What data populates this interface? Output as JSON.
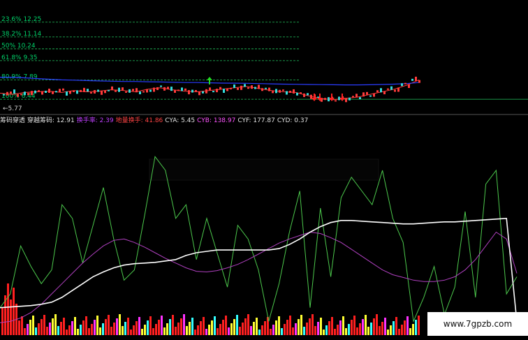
{
  "colors": {
    "background": "#000000",
    "fib_line": "#22c55e",
    "ma_blue": "#2a3cff",
    "candle_up": "#ff3b3b",
    "candle_down": "#33dddd",
    "green_line": "#4cc94c",
    "purple_line": "#b040c0",
    "white_line": "#ffffff",
    "vol_red": "#ff2020",
    "vol_yellow": "#ffff33",
    "vol_cyan": "#33ffff",
    "vol_magenta": "#ff33ff"
  },
  "chart_data": [
    {
      "type": "line",
      "fib_levels": [
        {
          "label": "23.6% 12.25",
          "value": 12.25
        },
        {
          "label": "38.2% 11.14",
          "value": 11.14
        },
        {
          "label": "50% 10.24",
          "value": 10.24
        },
        {
          "label": "61.8% 9.35",
          "value": 9.35
        },
        {
          "label": "80.9% 7.89",
          "value": 7.89
        },
        {
          "label": "100% 6.44",
          "value": 6.44
        }
      ],
      "low_label": "5.77",
      "low_value": 5.77,
      "ylim": [
        5.5,
        13.5
      ],
      "series": [
        {
          "color": "#ff3b3b",
          "values": [
            6.9,
            6.8,
            6.95,
            7.0,
            7.05,
            6.95,
            7.1,
            7.0,
            7.05,
            7.15,
            7.1,
            7.0,
            7.2,
            7.3,
            7.15,
            7.05,
            7.0,
            7.1,
            7.2,
            7.3,
            7.4,
            7.25,
            7.1,
            7.0,
            6.95,
            6.7,
            6.5,
            6.4,
            6.5,
            6.6,
            6.8,
            7.0,
            7.2,
            7.5,
            7.9
          ]
        },
        {
          "color": "#2a3cff",
          "values": [
            8.1,
            8.1,
            8.05,
            8.0,
            7.95,
            7.9,
            7.88,
            7.85,
            7.82,
            7.8,
            7.78,
            7.78,
            7.76,
            7.74,
            7.72,
            7.7,
            7.7,
            7.68,
            7.66,
            7.65,
            7.64,
            7.62,
            7.6,
            7.58,
            7.57,
            7.55,
            7.54,
            7.53,
            7.52,
            7.52,
            7.53,
            7.55,
            7.58,
            7.62,
            7.7
          ]
        }
      ]
    },
    {
      "type": "line",
      "indicator_labels": [
        {
          "text": "筹码穿透",
          "color": "#e0e0e0"
        },
        {
          "text": "穿越筹码: 12.91",
          "color": "#e0e0e0"
        },
        {
          "text": "换手率: 2.39",
          "color": "#c040ff"
        },
        {
          "text": "地量换手: 41.86",
          "color": "#ff4444"
        },
        {
          "text": "CYA: 5.45",
          "color": "#e0e0e0"
        },
        {
          "text": "CYB: 138.97",
          "color": "#ff55ff"
        },
        {
          "text": "CYF: 177.87",
          "color": "#e0e0e0"
        },
        {
          "text": "CYD: 0.37",
          "color": "#e0e0e0"
        }
      ],
      "ylim": [
        0,
        300
      ],
      "series": [
        {
          "color": "#4cc94c",
          "values": [
            40,
            60,
            130,
            100,
            75,
            95,
            190,
            170,
            105,
            160,
            215,
            140,
            80,
            95,
            175,
            260,
            240,
            170,
            190,
            110,
            170,
            120,
            70,
            160,
            140,
            95,
            20,
            75,
            150,
            210,
            40,
            185,
            85,
            200,
            230,
            210,
            190,
            240,
            170,
            135,
            20,
            55,
            100,
            30,
            70,
            180,
            55,
            220,
            240,
            60,
            85
          ]
        },
        {
          "color": "#b040c0",
          "values": [
            18,
            20,
            25,
            33,
            45,
            60,
            75,
            90,
            105,
            118,
            130,
            138,
            140,
            135,
            128,
            120,
            112,
            105,
            98,
            93,
            92,
            94,
            98,
            103,
            110,
            118,
            126,
            134,
            140,
            145,
            150,
            148,
            142,
            135,
            125,
            115,
            105,
            95,
            88,
            84,
            80,
            78,
            78,
            80,
            85,
            95,
            110,
            130,
            150,
            140,
            90
          ]
        },
        {
          "color": "#ffffff",
          "values": [
            40,
            41,
            42,
            43,
            45,
            48,
            55,
            65,
            75,
            85,
            92,
            98,
            102,
            104,
            105,
            106,
            108,
            110,
            116,
            120,
            122,
            124,
            124,
            124,
            124,
            124,
            124,
            126,
            132,
            140,
            150,
            158,
            164,
            167,
            167,
            166,
            165,
            164,
            163,
            162,
            162,
            163,
            164,
            165,
            165,
            166,
            167,
            168,
            169,
            170,
            20
          ]
        }
      ]
    }
  ],
  "watermark": "www.7gpzb.com"
}
